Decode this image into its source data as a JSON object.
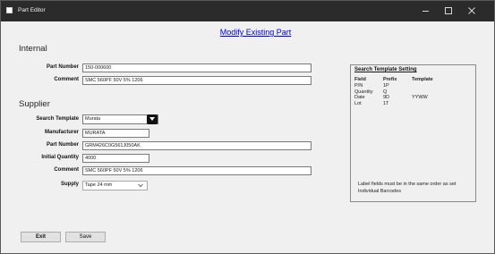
{
  "window": {
    "title": "Part Editor",
    "controls": {
      "minimize": "minimize-icon",
      "maximize": "maximize-icon",
      "close": "close-icon"
    }
  },
  "heading": "Modify Existing Part",
  "internal": {
    "section_title": "Internal",
    "part_number_label": "Part Number",
    "part_number_value": "150-000600",
    "comment_label": "Comment",
    "comment_value": "SMC 560PF 50V 5% 1206"
  },
  "supplier": {
    "section_title": "Supplier",
    "search_template_label": "Search Template",
    "search_template_value": "Murata",
    "manufacturer_label": "Manufacturer",
    "manufacturer_value": "MURATA",
    "part_number_label": "Part Number",
    "part_number_value": "GRM426C0G561J050AK",
    "initial_quantity_label": "Initial Quantity",
    "initial_quantity_value": "4000",
    "comment_label": "Comment",
    "comment_value": "SMC 560PF 50V 5% 1206",
    "supply_label": "Supply",
    "supply_value": "Tape 24 mm"
  },
  "template_panel": {
    "title": "Search Template Setting",
    "columns": [
      "Field",
      "Prefix",
      "Template"
    ],
    "rows": [
      {
        "field": "P/N",
        "prefix": "1P",
        "template": ""
      },
      {
        "field": "Quantity",
        "prefix": "Q",
        "template": ""
      },
      {
        "field": "Date",
        "prefix": "9D",
        "template": "YYWW"
      },
      {
        "field": "Lot",
        "prefix": "1T",
        "template": ""
      }
    ],
    "note": "Label fields must be in the same order as set Individual Barcodes"
  },
  "buttons": {
    "exit": "Exit",
    "save": "Save"
  },
  "colors": {
    "titlebar": "#2b2b2b",
    "window_bg": "#f0f0f0",
    "link": "#0000ee"
  }
}
